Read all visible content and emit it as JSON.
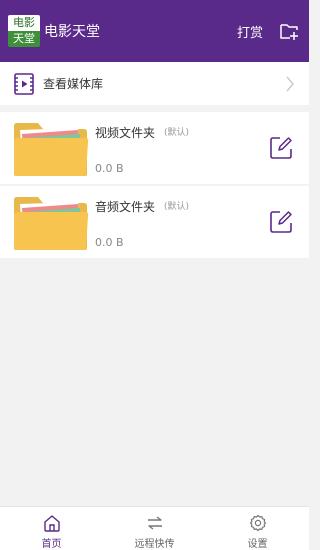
{
  "header": {
    "logo_top": "电影",
    "logo_bottom": "天堂",
    "title": "电影天堂",
    "tip_label": "打赏",
    "add_icon": "add-folder-icon"
  },
  "media": {
    "label": "查看媒体库",
    "icon": "media-library-icon"
  },
  "folders": [
    {
      "name": "视频文件夹",
      "tag": "(默认)",
      "size": "0.0 B"
    },
    {
      "name": "音频文件夹",
      "tag": "(默认)",
      "size": "0.0 B"
    }
  ],
  "nav": [
    {
      "label": "首页",
      "icon": "home-icon",
      "active": true
    },
    {
      "label": "远程快传",
      "icon": "transfer-icon",
      "active": false
    },
    {
      "label": "设置",
      "icon": "settings-icon",
      "active": false
    }
  ],
  "colors": {
    "brand": "#5a2a8a",
    "folder": "#f7c54f",
    "logo_green": "#3f8f3a"
  }
}
